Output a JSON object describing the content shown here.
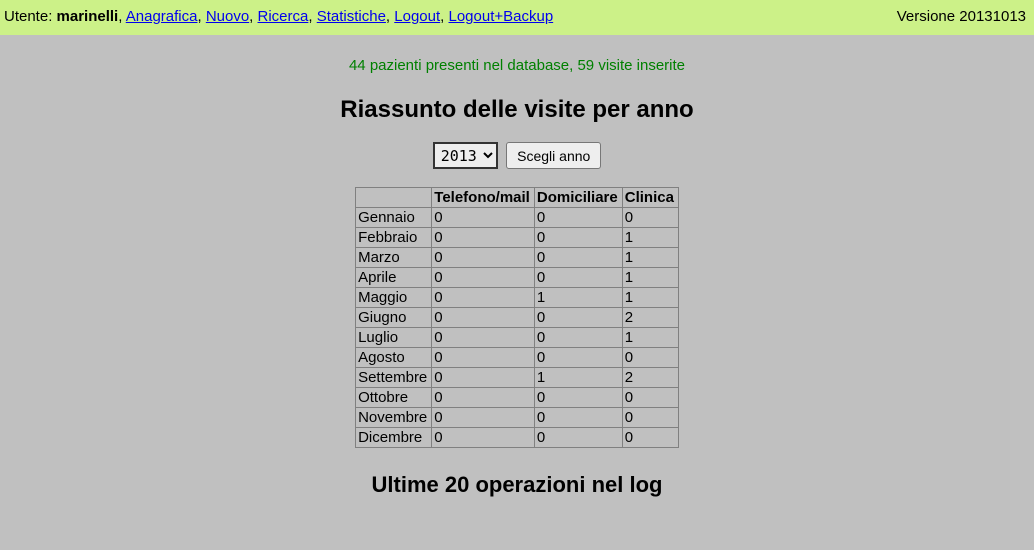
{
  "topbar": {
    "user_label": "Utente: ",
    "username": "marinelli",
    "links": [
      "Anagrafica",
      "Nuovo",
      "Ricerca",
      "Statistiche",
      "Logout",
      "Logout+Backup"
    ],
    "version": "Versione 20131013"
  },
  "stats_line": "44 pazienti presenti nel database, 59 visite inserite",
  "title": "Riassunto delle visite per anno",
  "year_form": {
    "selected_year": "2013",
    "button_label": "Scegli anno"
  },
  "table": {
    "columns": [
      "Telefono/mail",
      "Domiciliare",
      "Clinica"
    ],
    "rows": [
      {
        "label": "Gennaio",
        "values": [
          "0",
          "0",
          "0"
        ]
      },
      {
        "label": "Febbraio",
        "values": [
          "0",
          "0",
          "1"
        ]
      },
      {
        "label": "Marzo",
        "values": [
          "0",
          "0",
          "1"
        ]
      },
      {
        "label": "Aprile",
        "values": [
          "0",
          "0",
          "1"
        ]
      },
      {
        "label": "Maggio",
        "values": [
          "0",
          "1",
          "1"
        ]
      },
      {
        "label": "Giugno",
        "values": [
          "0",
          "0",
          "2"
        ]
      },
      {
        "label": "Luglio",
        "values": [
          "0",
          "0",
          "1"
        ]
      },
      {
        "label": "Agosto",
        "values": [
          "0",
          "0",
          "0"
        ]
      },
      {
        "label": "Settembre",
        "values": [
          "0",
          "1",
          "2"
        ]
      },
      {
        "label": "Ottobre",
        "values": [
          "0",
          "0",
          "0"
        ]
      },
      {
        "label": "Novembre",
        "values": [
          "0",
          "0",
          "0"
        ]
      },
      {
        "label": "Dicembre",
        "values": [
          "0",
          "0",
          "0"
        ]
      }
    ]
  },
  "subtitle": "Ultime 20 operazioni nel log"
}
